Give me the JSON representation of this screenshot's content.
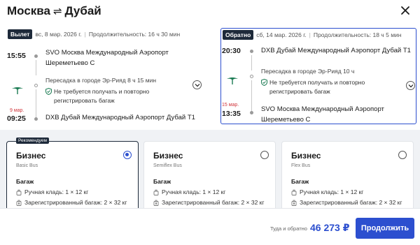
{
  "header": {
    "origin": "Москва",
    "swap_glyph": "⇌",
    "destination": "Дубай"
  },
  "outbound": {
    "badge": "Вылет",
    "date": "вс, 8 мар. 2026 г.",
    "duration": "Продолжительность: 16 ч 30 мин",
    "dep_time": "15:55",
    "dep_airport_line1": "SVO Москва Международный Аэропорт",
    "dep_airport_line2": "Шереметьево С",
    "transfer": "Пересадка в городе Эр-Рияд  8 ч 15 мин",
    "bag_note_line1": "Не требуется получать и повторно",
    "bag_note_line2": "регистрировать багаж",
    "arr_date": "9 мар.",
    "arr_time": "09:25",
    "arr_airport": "DXB Дубай Международный Аэропорт Дубай T1"
  },
  "return": {
    "badge": "Обратно",
    "date": "сб, 14 мар. 2026 г.",
    "duration": "Продолжительность: 18 ч 5 мин",
    "dep_time": "20:30",
    "dep_airport": "DXB Дубай Международный Аэропорт Дубай T1",
    "transfer": "Пересадка в городе Эр-Рияд  10 ч",
    "bag_note_line1": "Не требуется получать и повторно",
    "bag_note_line2": "регистрировать багаж",
    "arr_date": "15 мар.",
    "arr_time": "13:35",
    "arr_airport_line1": "SVO Москва Международный Аэропорт",
    "arr_airport_line2": "Шереметьево С"
  },
  "fares": [
    {
      "tag": "Рекомендуем",
      "name": "Бизнес",
      "sub": "Basic Bus",
      "selected": true,
      "bag_title": "Багаж",
      "hand": "Ручная кладь: 1 × 12 кг",
      "checked": "Зарегистрированный багаж: 2 × 32 кг"
    },
    {
      "tag": "",
      "name": "Бизнес",
      "sub": "Semiflex Bus",
      "selected": false,
      "bag_title": "Багаж",
      "hand": "Ручная кладь: 1 × 12 кг",
      "checked": "Зарегистрированный багаж: 2 × 32 кг"
    },
    {
      "tag": "",
      "name": "Бизнес",
      "sub": "Flex Bus",
      "selected": false,
      "bag_title": "Багаж",
      "hand": "Ручная кладь: 1 × 12 кг",
      "checked": "Зарегистрированный багаж: 2 × 32 кг"
    }
  ],
  "footer": {
    "price_label": "Туда и обратно",
    "price": "46 273 ₽",
    "continue_label": "Продолжить"
  },
  "colors": {
    "accent": "#2c4fcf",
    "badge_dark": "#1e2a3a",
    "date_red": "#d0343a",
    "fare_area_bg": "#f0f2f5",
    "airline_green": "#1c7c54"
  },
  "icons": [
    "swap-icon",
    "close-icon",
    "shield-check-icon",
    "airline-logo",
    "chevron-down-icon",
    "radio-icon",
    "hand-luggage-icon",
    "checked-bag-icon"
  ]
}
